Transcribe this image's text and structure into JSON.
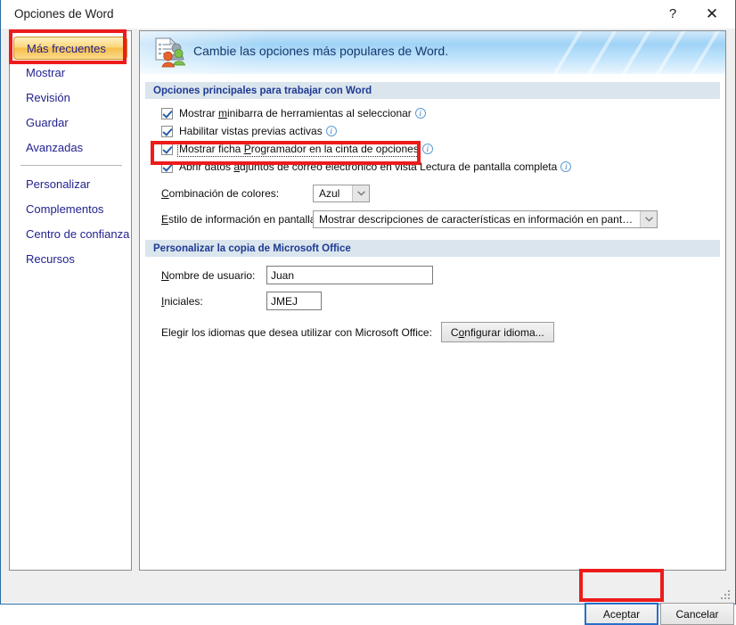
{
  "window": {
    "title": "Opciones de Word",
    "help_label": "?",
    "close_label": "✕"
  },
  "sidebar": {
    "items": [
      {
        "label": "Más frecuentes",
        "selected": true
      },
      {
        "label": "Mostrar",
        "selected": false
      },
      {
        "label": "Revisión",
        "selected": false
      },
      {
        "label": "Guardar",
        "selected": false
      },
      {
        "label": "Avanzadas",
        "selected": false
      },
      {
        "label": "Personalizar",
        "selected": false
      },
      {
        "label": "Complementos",
        "selected": false
      },
      {
        "label": "Centro de confianza",
        "selected": false
      },
      {
        "label": "Recursos",
        "selected": false
      }
    ]
  },
  "banner": {
    "icon": "options-people-icon",
    "text": "Cambie las opciones más populares de Word."
  },
  "section_main": {
    "header": "Opciones principales para trabajar con Word",
    "checkboxes": [
      {
        "pre": "Mostrar ",
        "accel": "m",
        "post": "inibarra de herramientas al seleccionar",
        "checked": true,
        "info": true,
        "focused": false
      },
      {
        "pre": "Habilitar vistas previas activas",
        "accel": "",
        "post": "",
        "checked": true,
        "info": true,
        "focused": false
      },
      {
        "pre": "Mostrar ficha ",
        "accel": "P",
        "post": "rogramador en la cinta de opciones",
        "checked": true,
        "info": true,
        "focused": true
      },
      {
        "pre": "Abrir datos ",
        "accel": "a",
        "post": "djuntos de correo electrónico en vista Lectura de pantalla completa",
        "checked": true,
        "info": true,
        "focused": false
      }
    ],
    "color_scheme": {
      "label_pre": "",
      "label_accel": "C",
      "label_post": "ombinación de colores:",
      "value": "Azul"
    },
    "screentip_style": {
      "label_pre": "",
      "label_accel": "E",
      "label_post": "stilo de información en pantalla:",
      "value": "Mostrar descripciones de características en información en pantalla"
    }
  },
  "section_personalize": {
    "header": "Personalizar la copia de Microsoft Office",
    "username": {
      "label_accel": "N",
      "label_post": "ombre de usuario:",
      "value": "Juan"
    },
    "initials": {
      "label_accel": "I",
      "label_post": "niciales:",
      "value": "JMEJ"
    },
    "language": {
      "label": "Elegir los idiomas que desea utilizar con Microsoft Office:",
      "button_pre": "C",
      "button_accel": "o",
      "button_post": "nfigurar idioma..."
    }
  },
  "footer": {
    "ok_label": "Aceptar",
    "cancel_label": "Cancelar"
  },
  "annotations": {
    "highlight_color": "#ee1b1b",
    "boxes": [
      {
        "name": "sidebar-selected-highlight"
      },
      {
        "name": "developer-tab-checkbox-highlight"
      },
      {
        "name": "ok-button-highlight"
      }
    ]
  }
}
